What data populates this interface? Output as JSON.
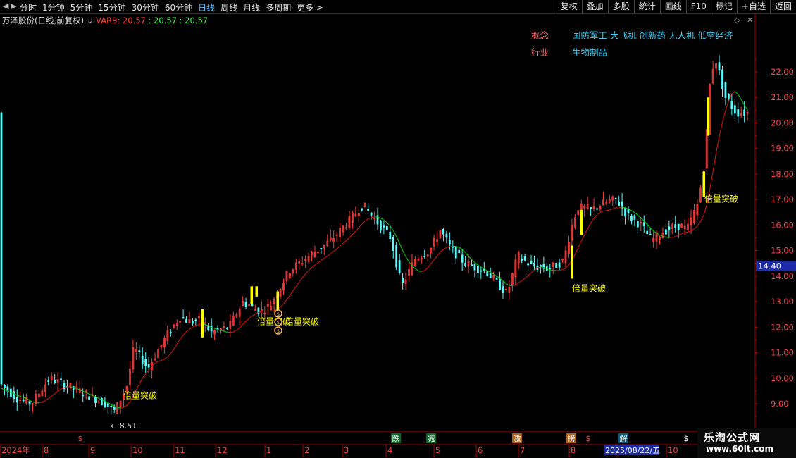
{
  "toolbar": {
    "periods": [
      "分时",
      "1分钟",
      "5分钟",
      "15分钟",
      "30分钟",
      "60分钟",
      "日线",
      "周线",
      "月线",
      "多周期",
      "更多 >"
    ],
    "active_period": "日线",
    "right_buttons": [
      "复权",
      "叠加",
      "多股",
      "统计",
      "画线",
      "F10",
      "标记",
      "+自选",
      "返回"
    ]
  },
  "info": {
    "title": "万泽股份(日线,前复权)",
    "var_label": "VAR9: 20.57",
    "var_val2": ": 20.57",
    "var_val3": ": 20.57"
  },
  "concept": {
    "concept_label": "概念",
    "concept_value": "国防军工 大飞机 创新药 无人机 低空经济",
    "industry_label": "行业",
    "industry_value": "生物制品"
  },
  "y_axis": {
    "ticks": [
      "22.00",
      "21.00",
      "20.00",
      "19.00",
      "18.00",
      "17.00",
      "16.00",
      "15.00",
      "14.00",
      "13.00",
      "12.00",
      "11.00",
      "10.00",
      "9.00"
    ],
    "tick_values": [
      22,
      21,
      20,
      19,
      18,
      17,
      16,
      15,
      14,
      13,
      12,
      11,
      10,
      9
    ],
    "current_price": "14.40",
    "current_value": 14.4
  },
  "x_axis": {
    "labels": [
      "2024年",
      "8",
      "9",
      "10",
      "11",
      "12",
      "1",
      "2",
      "3",
      "4",
      "5",
      "6",
      "7",
      "8",
      "9",
      "10"
    ],
    "selected_date": "2025/08/22/五"
  },
  "event_markers": [
    "跌",
    "减",
    "激",
    "榜",
    "解",
    "$",
    "$",
    "$"
  ],
  "annotations": {
    "low_label": "← 8.51",
    "breakout_label": "倍量突破",
    "overlap_label": "倍量突破"
  },
  "colors": {
    "up": "#ff3c3c",
    "down": "#54ffff",
    "ma_up": "#e01010",
    "ma_down": "#00d000",
    "highlight": "#ffff00",
    "axis": "#b00000",
    "accent": "#4ec3ff"
  },
  "chart_data": {
    "type": "candlestick",
    "ylim": [
      8.3,
      23.7
    ],
    "anchors": [
      [
        0,
        9.8
      ],
      [
        25,
        9.2
      ],
      [
        45,
        9.0
      ],
      [
        70,
        10.0
      ],
      [
        95,
        9.7
      ],
      [
        120,
        9.4
      ],
      [
        150,
        9.0
      ],
      [
        163,
        8.7
      ],
      [
        180,
        9.7
      ],
      [
        190,
        11.2
      ],
      [
        210,
        10.4
      ],
      [
        235,
        11.6
      ],
      [
        255,
        12.4
      ],
      [
        270,
        12.2
      ],
      [
        285,
        12.3
      ],
      [
        300,
        11.8
      ],
      [
        325,
        12.0
      ],
      [
        345,
        13.0
      ],
      [
        370,
        12.6
      ],
      [
        385,
        12.9
      ],
      [
        410,
        14.2
      ],
      [
        440,
        14.8
      ],
      [
        470,
        15.4
      ],
      [
        500,
        16.3
      ],
      [
        515,
        16.8
      ],
      [
        530,
        16.3
      ],
      [
        555,
        15.5
      ],
      [
        570,
        13.6
      ],
      [
        590,
        14.7
      ],
      [
        610,
        15.0
      ],
      [
        625,
        15.8
      ],
      [
        640,
        15.1
      ],
      [
        660,
        14.5
      ],
      [
        690,
        14.2
      ],
      [
        720,
        13.3
      ],
      [
        735,
        14.8
      ],
      [
        755,
        14.4
      ],
      [
        780,
        14.3
      ],
      [
        800,
        14.6
      ],
      [
        812,
        16.0
      ],
      [
        820,
        16.7
      ],
      [
        840,
        16.6
      ],
      [
        860,
        16.9
      ],
      [
        875,
        17.0
      ],
      [
        890,
        16.4
      ],
      [
        910,
        16.0
      ],
      [
        925,
        15.4
      ],
      [
        945,
        15.8
      ],
      [
        965,
        16.0
      ],
      [
        975,
        15.8
      ],
      [
        990,
        16.8
      ],
      [
        1000,
        18.3
      ],
      [
        1008,
        21.6
      ],
      [
        1015,
        22.6
      ],
      [
        1030,
        21.0
      ],
      [
        1045,
        20.4
      ],
      [
        1063,
        20.4
      ]
    ],
    "yellow_bars": [
      [
        287,
        11.6,
        12.7
      ],
      [
        357,
        12.9,
        13.6
      ],
      [
        364,
        13.2,
        13.6
      ],
      [
        394,
        12.6,
        13.4
      ],
      [
        812,
        13.9,
        15.2
      ],
      [
        825,
        15.6,
        16.6
      ],
      [
        999,
        17.1,
        18.1
      ],
      [
        1005,
        19.5,
        21.0
      ]
    ],
    "breakout_points": [
      [
        175,
        9.7
      ],
      [
        365,
        12.6
      ],
      [
        405,
        12.6
      ],
      [
        812,
        13.9
      ],
      [
        1000,
        17.4
      ]
    ],
    "low_point": [
      160,
      8.51
    ]
  }
}
